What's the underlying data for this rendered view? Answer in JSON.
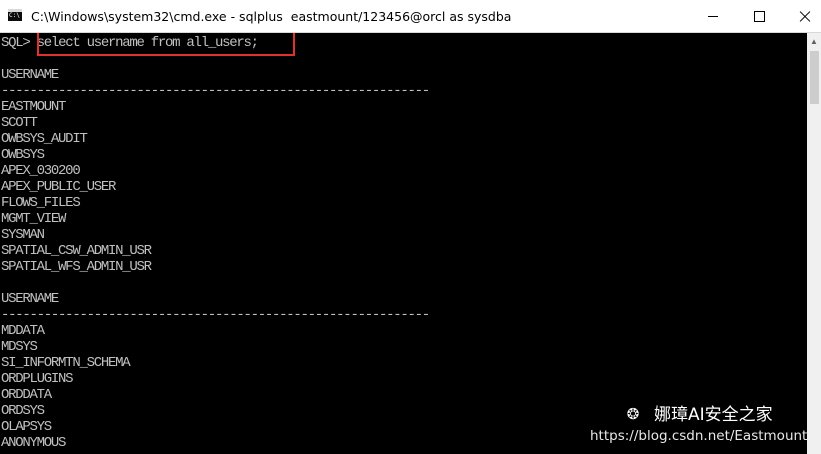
{
  "window": {
    "title": "C:\\Windows\\system32\\cmd.exe - sqlplus  eastmount/123456@orcl as sysdba",
    "icon": "cmd-icon",
    "icon_glyph": "C:\\",
    "minimize_icon": "minimize-icon",
    "maximize_icon": "maximize-icon",
    "close_icon": "close-icon"
  },
  "console": {
    "prompt": "SQL> ",
    "command": "select username from all_users;",
    "header1": "USERNAME",
    "separator1": "------------------------------------------------------------",
    "group1": [
      "EASTMOUNT",
      "SCOTT",
      "OWBSYS_AUDIT",
      "OWBSYS",
      "APEX_030200",
      "APEX_PUBLIC_USER",
      "FLOWS_FILES",
      "MGMT_VIEW",
      "SYSMAN",
      "SPATIAL_CSW_ADMIN_USR",
      "SPATIAL_WFS_ADMIN_USR"
    ],
    "header2": "USERNAME",
    "separator2": "------------------------------------------------------------",
    "group2": [
      "MDDATA",
      "MDSYS",
      "SI_INFORMTN_SCHEMA",
      "ORDPLUGINS",
      "ORDDATA",
      "ORDSYS",
      "OLAPSYS",
      "ANONYMOUS"
    ],
    "colors": {
      "background": "#000000",
      "text": "#c0c0c0",
      "highlight": "#e0312e"
    }
  },
  "watermark": {
    "logo_icon": "wechat-icon",
    "title": "娜璋AI安全之家",
    "url": "https://blog.csdn.net/Eastmount"
  }
}
